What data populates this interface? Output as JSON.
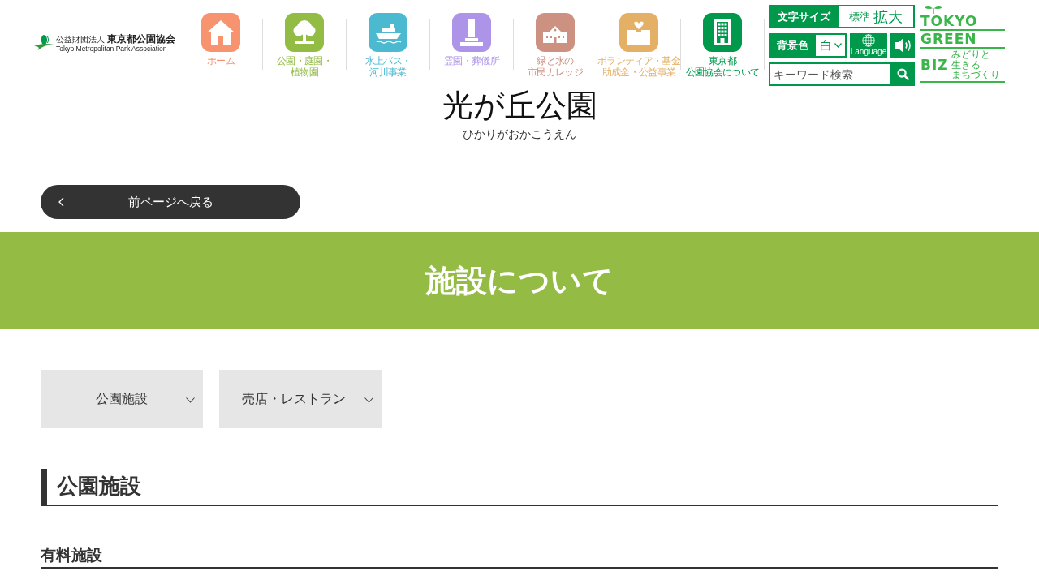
{
  "header": {
    "org_logo": {
      "prefix": "公益財団法人",
      "name": "東京都公園協会",
      "english": "Tokyo Metropolitan Park Association"
    },
    "nav": [
      {
        "kind": "home",
        "label_lines": [
          "ホーム"
        ],
        "color": "#f7936f"
      },
      {
        "kind": "tree",
        "label_lines": [
          "公園・庭園・",
          "植物園"
        ],
        "color": "#93bc45"
      },
      {
        "kind": "ship",
        "label_lines": [
          "水上バス・",
          "河川事業"
        ],
        "color": "#4bbad1"
      },
      {
        "kind": "grave",
        "label_lines": [
          "霊園・葬儀所"
        ],
        "color": "#ad94e8"
      },
      {
        "kind": "school",
        "label_lines": [
          "緑と水の",
          "市民カレッジ"
        ],
        "color": "#cc9181"
      },
      {
        "kind": "donation",
        "label_lines": [
          "ボランティア・基金",
          "助成金・公益事業"
        ],
        "color": "#e3b066"
      },
      {
        "kind": "office",
        "label_lines": [
          "東京都",
          "公園協会について"
        ],
        "color": "#00994c"
      }
    ],
    "font_size": {
      "label": "文字サイズ",
      "options": [
        {
          "label": "標準",
          "kind": "normal"
        },
        {
          "label": "拡大",
          "kind": "large"
        }
      ]
    },
    "background_color": {
      "label": "背景色",
      "value": "白"
    },
    "language": {
      "label": "Language"
    },
    "search": {
      "placeholder": "キーワード検索"
    },
    "green_biz_logo": {
      "words": [
        "TOKYO",
        "GREEN",
        "BIZ"
      ],
      "tagline_lines": [
        "みどりと",
        "生きる",
        "まちづくり"
      ]
    }
  },
  "park": {
    "title": "光が丘公園",
    "reading": "ひかりがおかこうえん"
  },
  "back_button": {
    "label": "前ページへ戻る"
  },
  "banner": {
    "title": "施設について"
  },
  "anchor_tabs": [
    {
      "label": "公園施設"
    },
    {
      "label": "売店・レストラン"
    }
  ],
  "section": {
    "heading": "公園施設",
    "subheading": "有料施設"
  }
}
